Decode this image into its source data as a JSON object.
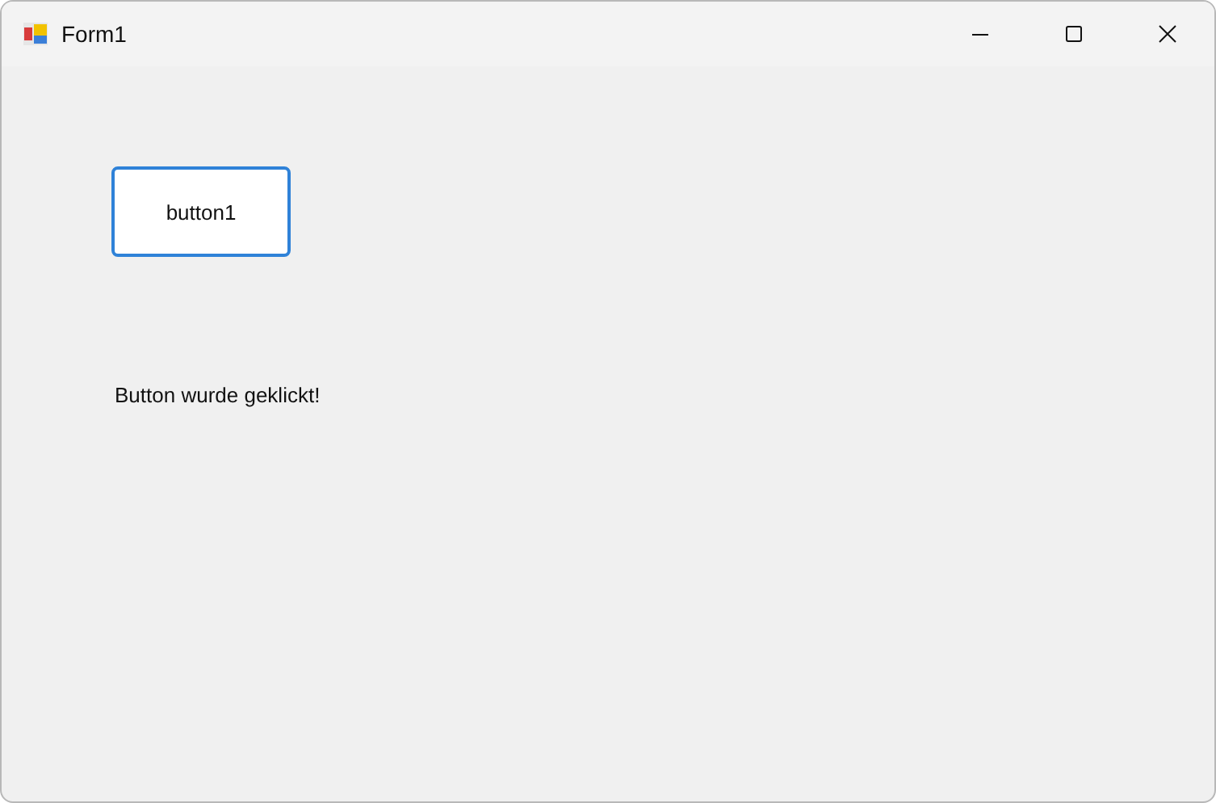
{
  "window": {
    "title": "Form1"
  },
  "button": {
    "label": "button1",
    "focused": true
  },
  "label": {
    "text": "Button wurde geklickt!"
  }
}
